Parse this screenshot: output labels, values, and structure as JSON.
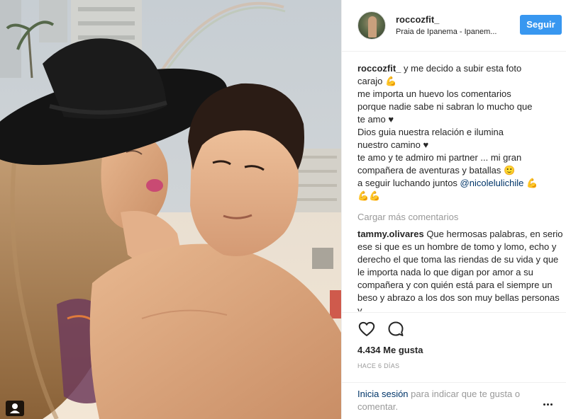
{
  "header": {
    "username": "roccozfit_",
    "location": "Praia de Ipanema - Ipanem...",
    "follow_label": "Seguir"
  },
  "caption": {
    "author": "roccozfit_",
    "lines": [
      " y me decido a subir esta foto",
      "carajo 💪",
      "me importa un huevo los comentarios",
      "porque nadie sabe ni sabran lo mucho que",
      "te amo ♥",
      "Dios guia nuestra relación e ilumina",
      "nuestro camino ♥",
      "te amo y te admiro mi partner ... mi gran",
      "compañera de aventuras y batallas 🙂",
      "a seguir luchando juntos "
    ],
    "mention": "@nicolelulichile",
    "trailing_emoji": " 💪",
    "last_line": "💪💪"
  },
  "load_more": "Cargar más comentarios",
  "comment": {
    "author": "tammy.olivares",
    "text": " Que hermosas palabras, en serio ese si que es un hombre de tomo y lomo, echo y derecho el que toma las riendas de su vida y que le importa nada lo que digan por amor a su compañera y con quién está para el siempre un beso y abrazo a los dos son muy bellas personas y"
  },
  "actions": {
    "like_icon": "heart-outline-icon",
    "comment_icon": "comment-bubble-icon",
    "likes": "4.434 Me gusta",
    "time_ago": "HACE 6 DÍAS"
  },
  "login": {
    "link": "Inicia sesión",
    "text": " para indicar que te gusta o comentar.",
    "more_icon": "more-options-icon"
  },
  "colors": {
    "accent": "#3897f0",
    "link": "#003569",
    "muted": "#999999",
    "text": "#262626"
  }
}
